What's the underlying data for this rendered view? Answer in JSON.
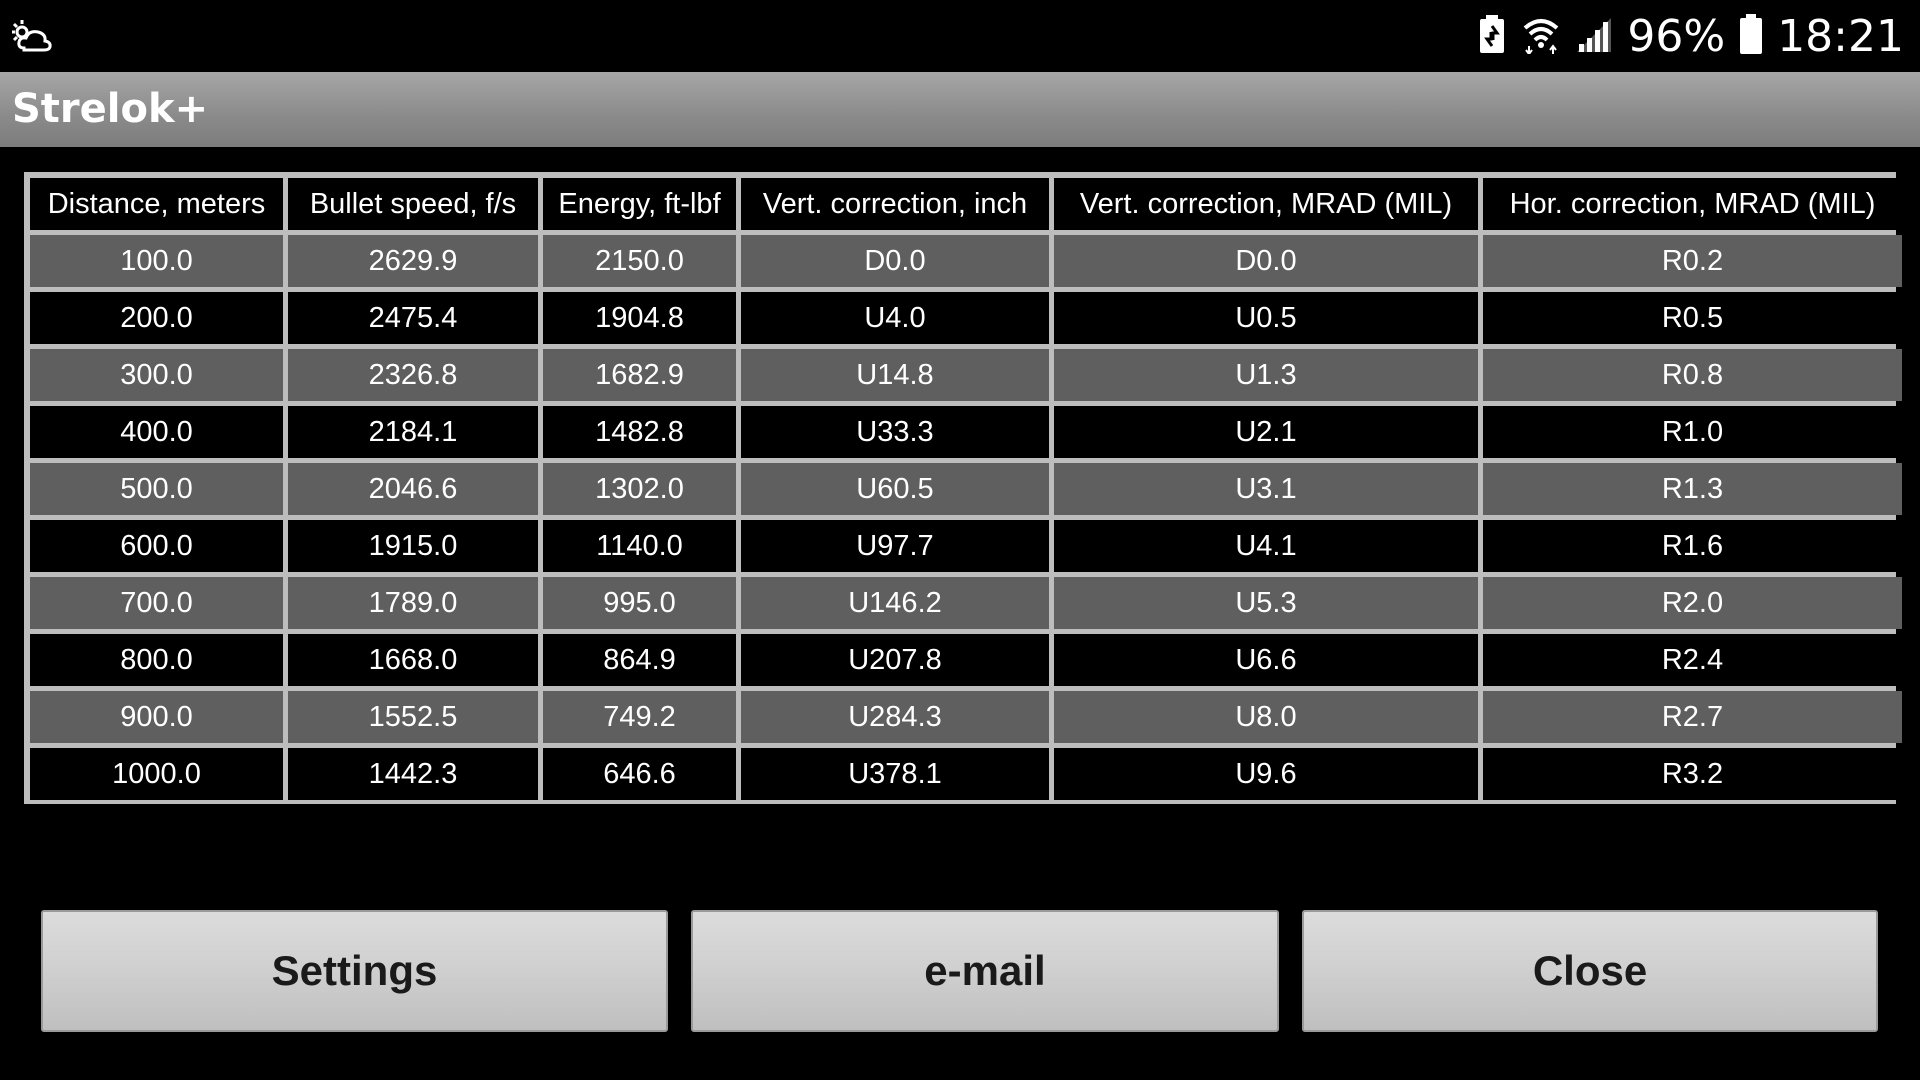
{
  "status_bar": {
    "battery_percent": "96%",
    "time": "18:21",
    "icons": [
      "weather-cloud-icon",
      "battery-saver-icon",
      "wifi-icon",
      "signal-icon",
      "battery-icon"
    ]
  },
  "app": {
    "title": "Strelok+"
  },
  "table": {
    "headers": [
      "Distance, meters",
      "Bullet speed, f/s",
      "Energy, ft-lbf",
      "Vert. correction, inch",
      "Vert. correction, MRAD (MIL)",
      "Hor. correction, MRAD (MIL)"
    ],
    "rows": [
      [
        "100.0",
        "2629.9",
        "2150.0",
        "D0.0",
        "D0.0",
        "R0.2"
      ],
      [
        "200.0",
        "2475.4",
        "1904.8",
        "U4.0",
        "U0.5",
        "R0.5"
      ],
      [
        "300.0",
        "2326.8",
        "1682.9",
        "U14.8",
        "U1.3",
        "R0.8"
      ],
      [
        "400.0",
        "2184.1",
        "1482.8",
        "U33.3",
        "U2.1",
        "R1.0"
      ],
      [
        "500.0",
        "2046.6",
        "1302.0",
        "U60.5",
        "U3.1",
        "R1.3"
      ],
      [
        "600.0",
        "1915.0",
        "1140.0",
        "U97.7",
        "U4.1",
        "R1.6"
      ],
      [
        "700.0",
        "1789.0",
        "995.0",
        "U146.2",
        "U5.3",
        "R2.0"
      ],
      [
        "800.0",
        "1668.0",
        "864.9",
        "U207.8",
        "U6.6",
        "R2.4"
      ],
      [
        "900.0",
        "1552.5",
        "749.2",
        "U284.3",
        "U8.0",
        "R2.7"
      ],
      [
        "1000.0",
        "1442.3",
        "646.6",
        "U378.1",
        "U9.6",
        "R3.2"
      ]
    ]
  },
  "buttons": {
    "settings": "Settings",
    "email": "e-mail",
    "close": "Close"
  },
  "colors": {
    "background": "#000000",
    "action_bar": "#8a8a8a",
    "row_alt": "#5f5f5f",
    "grid": "#bdbdbd",
    "button": "#cfcfcf"
  }
}
